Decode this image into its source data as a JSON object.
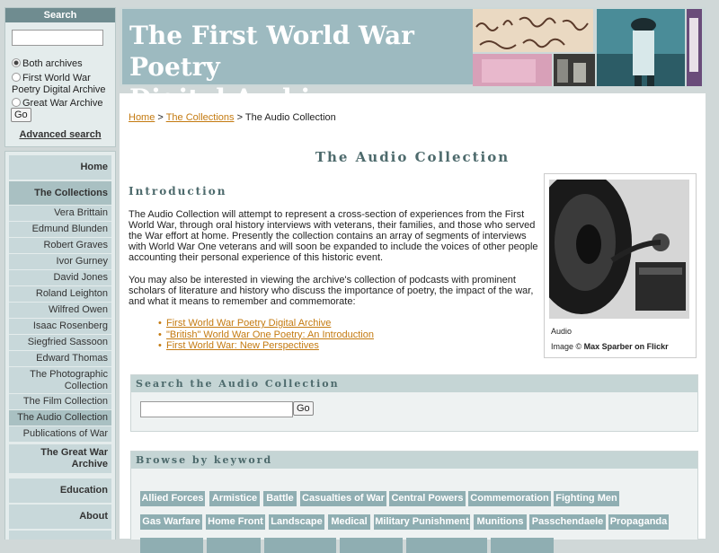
{
  "sidebar": {
    "search": {
      "heading": "Search",
      "options": [
        "Both archives",
        "First World War Poetry Digital Archive",
        "Great War Archive"
      ],
      "go_label": "Go",
      "advanced_label": "Advanced search"
    },
    "nav": {
      "home": "Home",
      "collections": "The Collections",
      "vera": "Vera Brittain",
      "edmund": "Edmund Blunden",
      "robert": "Robert Graves",
      "ivor": "Ivor Gurney",
      "david": "David Jones",
      "roland": "Roland Leighton",
      "wilfred": "Wilfred Owen",
      "isaac": "Isaac Rosenberg",
      "siegfried": "Siegfried Sassoon",
      "edward": "Edward Thomas",
      "photo": "The Photographic Collection",
      "film": "The Film Collection",
      "audio": "The Audio Collection",
      "publications": "Publications of War",
      "great_war": "The Great War Archive",
      "education": "Education",
      "about": "About"
    }
  },
  "header": {
    "title_line1": "The First World War Poetry",
    "title_line2": "Digital Archive"
  },
  "main": {
    "breadcrumb": {
      "home": "Home",
      "sep1": " > ",
      "collections": "The Collections",
      "sep2": " > ",
      "current": "The Audio Collection"
    },
    "title": "The Audio Collection",
    "intro_heading": "Introduction",
    "para1": "The Audio Collection will attempt to represent a cross-section of experiences from the First World War, through oral history interviews with veterans, their families, and those who served the War effort at home. Presently the collection contains an array of segments of interviews with World War One veterans and will soon be expanded to include the voices of other people accounting their personal experience of this historic event.",
    "para2": "You may also be interested in viewing the archive's collection of podcasts with prominent scholars of literature and history who discuss the importance of poetry, the impact of the war, and what it means to remember and commemorate:",
    "links": [
      "First World War Poetry Digital Archive",
      "\"British\" World War One Poetry: An Introduction",
      "First World War: New Perspectives"
    ],
    "photo_caption": "Audio",
    "photo_credit_prefix": "Image © ",
    "photo_credit_name": "Max Sparber on Flickr",
    "search_heading": "Search the Audio Collection",
    "search_go": "Go",
    "browse_heading": "Browse by keyword",
    "keywords_row1": [
      "Allied Forces",
      "Armistice",
      "Battle",
      "Casualties of War",
      "Central Powers",
      "Commemoration",
      "Fighting Men"
    ],
    "keywords_row2": [
      "Gas Warfare",
      "Home Front",
      "Landscape",
      "Medical",
      "Military Punishment",
      "Munitions",
      "Passchendaele",
      "Propaganda"
    ]
  },
  "colors": {
    "accent": "#6f8c90",
    "nav_bg": "#c8d8da",
    "nav_active": "#a9c0c2",
    "keyword_bg": "#8faeb2",
    "link": "#c47a10",
    "heading": "#4d6a6c"
  }
}
